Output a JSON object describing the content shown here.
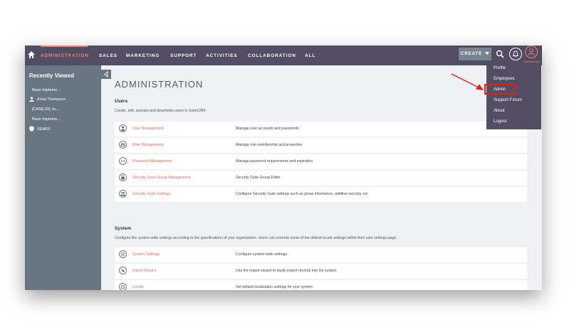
{
  "nav": {
    "items": [
      {
        "label": "ADMINISTRATION",
        "active": true
      },
      {
        "label": "SALES"
      },
      {
        "label": "MARKETING"
      },
      {
        "label": "SUPPORT"
      },
      {
        "label": "ACTIVITIES"
      },
      {
        "label": "COLLABORATION"
      },
      {
        "label": "ALL"
      }
    ],
    "create_label": "CREATE",
    "user_label": "Administrator"
  },
  "sidebar": {
    "title": "Recently Viewed",
    "items": [
      {
        "label": "Base Impleme...",
        "icon": "none"
      },
      {
        "label": "Anna Thompson",
        "icon": "person-icon"
      },
      {
        "label": "[CASE:29] Jo...",
        "icon": "none"
      },
      {
        "label": "Base Impleme...",
        "icon": "none"
      },
      {
        "label": "SEARS",
        "icon": "shield-icon"
      }
    ]
  },
  "page": {
    "title": "ADMINISTRATION",
    "users_section": {
      "title": "Users",
      "description": "Create, edit, activate and deactivate users in SuiteCRM.",
      "rows": [
        {
          "link": "User Management",
          "desc": "Manage user accounts and passwords",
          "icon": "user-icon"
        },
        {
          "link": "Role Management",
          "desc": "Manage role membership and properties",
          "icon": "role-icon"
        },
        {
          "link": "Password Management",
          "desc": "Manage password requirements and expiration",
          "icon": "password-icon"
        },
        {
          "link": "Security Suite Group Management",
          "desc": "Security Suite Group Editor",
          "icon": "lock-icon"
        },
        {
          "link": "Security Suite Settings",
          "desc": "Configure Security Suite settings such as group inheritance, additive security, etc",
          "icon": "group-icon"
        }
      ]
    },
    "system_section": {
      "title": "System",
      "description": "Configure the system-wide settings according to the specifications of your organization. Users can override some of the default locale settings within their user settings page.",
      "rows": [
        {
          "link": "System Settings",
          "desc": "Configure system-wide settings",
          "icon": "gear-icon"
        },
        {
          "link": "Import Wizard",
          "desc": "Use the import wizard to easily import records into the system",
          "icon": "import-icon"
        },
        {
          "link": "Locale",
          "desc": "Set default localization settings for your system",
          "icon": "locale-icon"
        }
      ]
    }
  },
  "dropdown": {
    "items": [
      "Profile",
      "Employees",
      "Admin",
      "Support Forum",
      "About",
      "Logout"
    ]
  },
  "colors": {
    "nav_bg": "#534d64",
    "accent": "#f08377",
    "sidebar_bg": "#687682",
    "link": "#e0695c",
    "highlight": "#e21b1b"
  }
}
